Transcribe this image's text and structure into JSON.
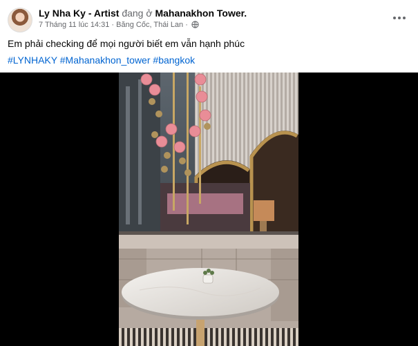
{
  "post": {
    "author": "Ly Nha Ky - Artist",
    "checkin_connector": "đang ở",
    "place": "Mahanakhon Tower.",
    "date": "7 Tháng 11 lúc 14:31",
    "location": "Băng Cốc, Thái Lan",
    "separator": "·",
    "text": "Em phải checking để mọi người biết em vẫn hạnh phúc",
    "hashtags": [
      "#LYNHAKY",
      "#Mahanakhon_tower",
      "#bangkok"
    ],
    "privacy_icon": "globe-icon",
    "menu_icon": "more-horizontal-icon"
  },
  "colors": {
    "link": "#0064d1",
    "secondary_text": "#65676b",
    "video_background": "#000000",
    "chandelier_globe": "#e98d97"
  }
}
